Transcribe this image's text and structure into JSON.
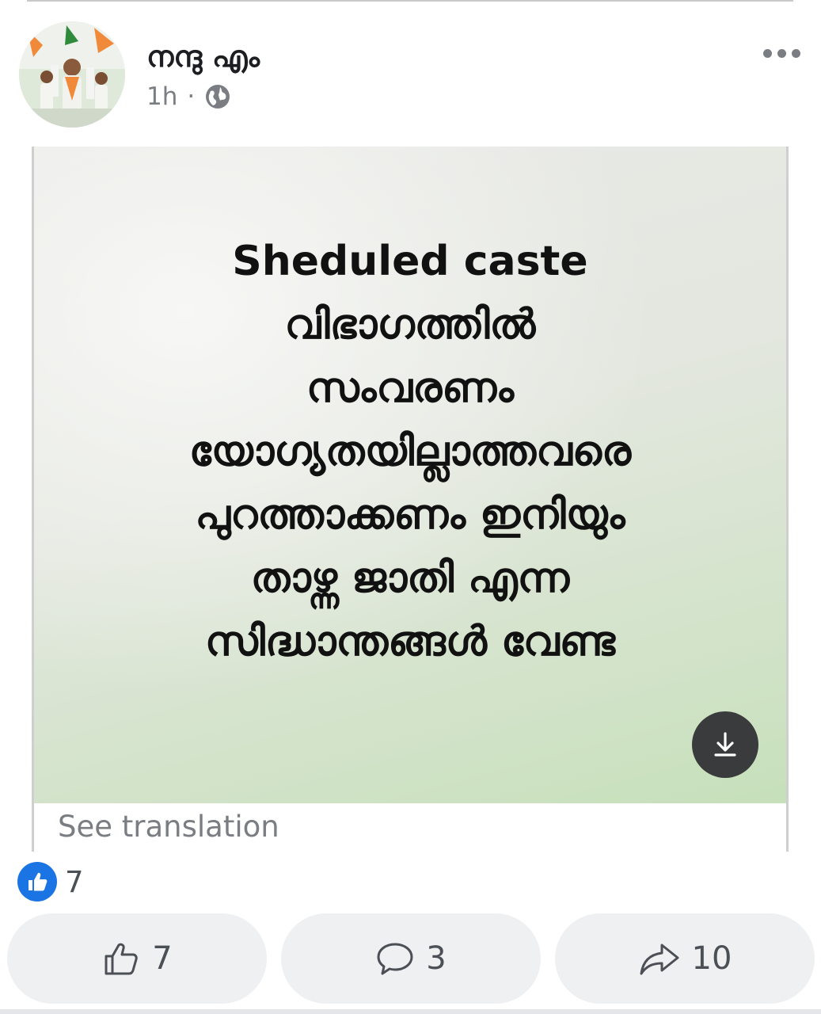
{
  "post": {
    "author": "നന്ദു എം",
    "time": "1h",
    "separator": "·",
    "privacy_icon": "globe-icon",
    "menu_icon": "more-horizontal-icon"
  },
  "image": {
    "lines": [
      "Sheduled caste",
      "വിഭാഗത്തിൽ",
      "സംവരണം",
      "യോഗ്യതയില്ലാത്തവരെ",
      "പുറത്താക്കണം ഇനിയും",
      "താഴ്ന്ന ജാതി എന്ന",
      "സിദ്ധാന്തങ്ങൾ വേണ്ട"
    ],
    "download_icon": "download-icon"
  },
  "see_translation": "See translation",
  "reactions": {
    "icon": "like-reaction-icon",
    "count": "7"
  },
  "actions": {
    "like_count": "7",
    "comment_count": "3",
    "share_count": "10"
  },
  "colors": {
    "accent": "#1b74e4",
    "button_bg": "#eff0f2",
    "muted_text": "#7a7d82"
  }
}
